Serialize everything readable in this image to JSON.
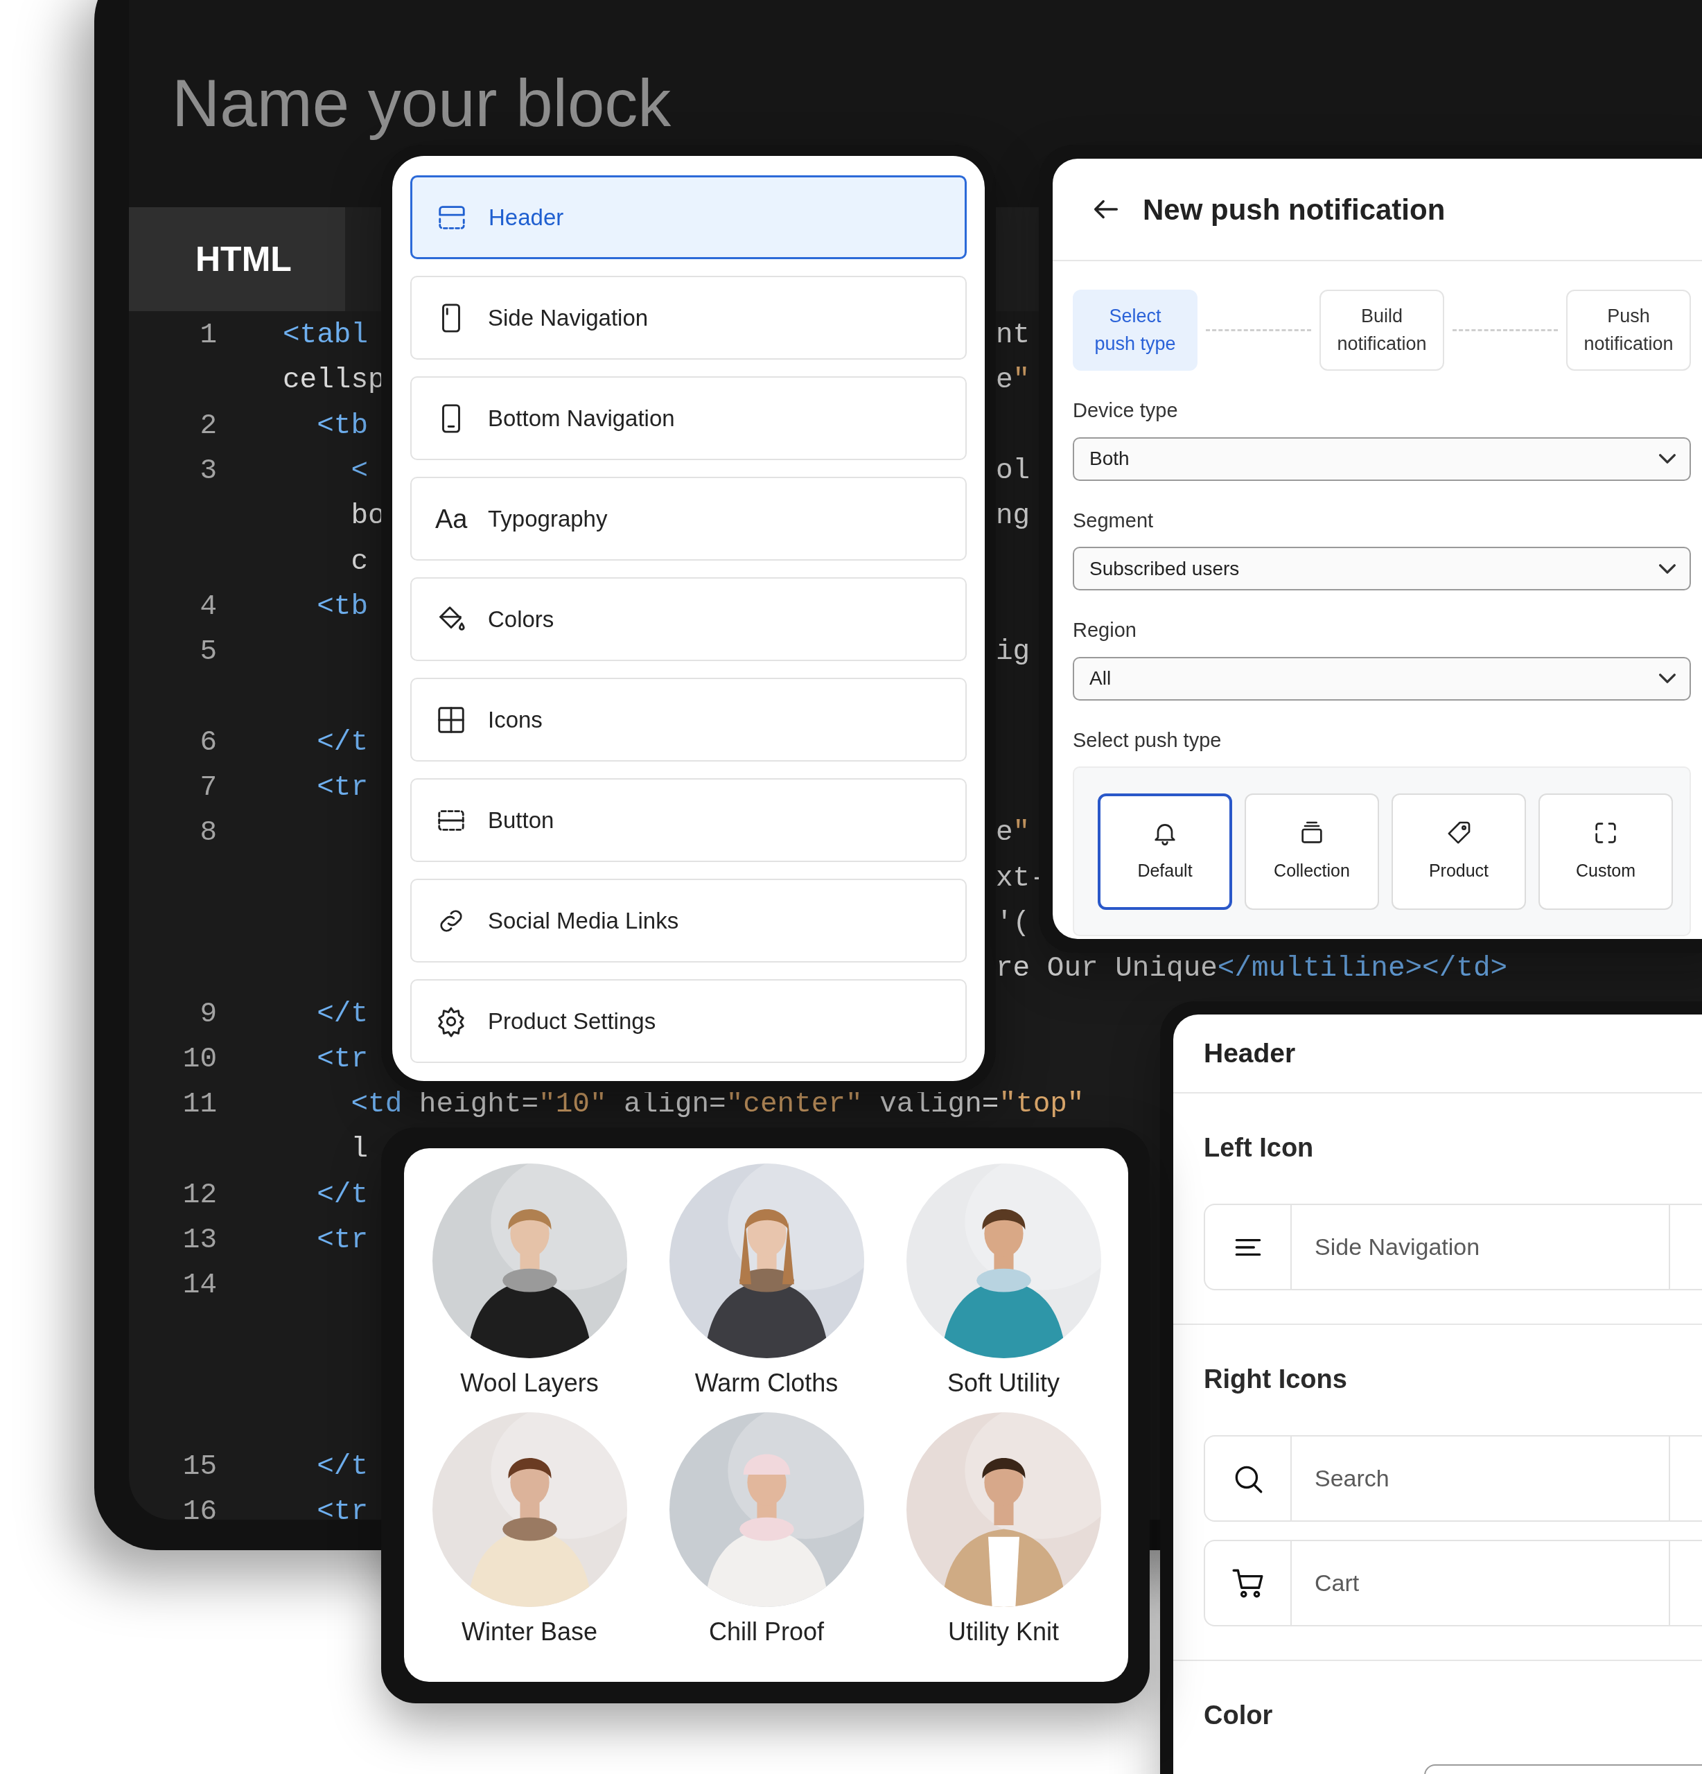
{
  "editor": {
    "title": "Name your block",
    "tabs": [
      {
        "label": "HTML",
        "selected": true
      }
    ],
    "lines": [
      {
        "number": "1",
        "rows": [
          {
            "code": "<tabl",
            "tail": "nt"
          },
          {
            "code": "cellsp",
            "tail": "e\""
          }
        ]
      },
      {
        "number": "2",
        "rows": [
          {
            "code": "  <tb"
          }
        ]
      },
      {
        "number": "3",
        "rows": [
          {
            "code": "    <",
            "tail": "ol"
          },
          {
            "code": "    bo",
            "tail": "ng"
          },
          {
            "code": "    c"
          }
        ]
      },
      {
        "number": "4",
        "rows": [
          {
            "code": "  <tb"
          }
        ]
      },
      {
        "number": "5",
        "rows": [
          {
            "tail": "ig"
          },
          {}
        ]
      },
      {
        "number": "6",
        "rows": [
          {
            "code": "  </t"
          }
        ]
      },
      {
        "number": "7",
        "rows": [
          {
            "code": "  <tr"
          }
        ]
      },
      {
        "number": "8",
        "rows": [
          {
            "tail": "e\""
          },
          {
            "tail": "xt-"
          },
          {
            "tail": "'("
          },
          {
            "tail": "re Our Unique</multiline></td>"
          }
        ]
      },
      {
        "number": "9",
        "rows": [
          {
            "code": "  </t"
          }
        ]
      },
      {
        "number": "10",
        "rows": [
          {
            "code": "  <tr"
          }
        ]
      },
      {
        "number": "11",
        "rows": [
          {
            "code": "    <td height=\"10\" align=\"center\" valign=\"top\""
          },
          {
            "code": "    l"
          }
        ]
      },
      {
        "number": "12",
        "rows": [
          {
            "code": "  </t"
          }
        ]
      },
      {
        "number": "13",
        "rows": [
          {
            "code": "  <tr"
          }
        ]
      },
      {
        "number": "14",
        "rows": [
          {},
          {},
          {},
          {}
        ]
      },
      {
        "number": "15",
        "rows": [
          {
            "code": "  </t"
          }
        ]
      },
      {
        "number": "16",
        "rows": [
          {
            "code": "  <tr"
          }
        ]
      }
    ]
  },
  "blocks_menu": {
    "items": [
      {
        "label": "Header",
        "selected": true
      },
      {
        "label": "Side Navigation",
        "selected": false
      },
      {
        "label": "Bottom Navigation",
        "selected": false
      },
      {
        "label": "Typography",
        "glyph": "Aa",
        "selected": false
      },
      {
        "label": "Colors",
        "selected": false
      },
      {
        "label": "Icons",
        "selected": false
      },
      {
        "label": "Button",
        "selected": false
      },
      {
        "label": "Social Media Links",
        "selected": false
      },
      {
        "label": "Product Settings",
        "selected": false
      }
    ]
  },
  "push_panel": {
    "title": "New push notification",
    "steps": [
      {
        "label": "Select push type",
        "selected": true
      },
      {
        "label": "Build notification",
        "selected": false
      },
      {
        "label": "Push notification",
        "selected": false
      }
    ],
    "fields": [
      {
        "label": "Device type",
        "value": "Both"
      },
      {
        "label": "Segment",
        "value": "Subscribed users"
      },
      {
        "label": "Region",
        "value": "All"
      }
    ],
    "push_type": {
      "label": "Select push type",
      "options": [
        {
          "label": "Default",
          "selected": true
        },
        {
          "label": "Collection",
          "selected": false
        },
        {
          "label": "Product",
          "selected": false
        },
        {
          "label": "Custom",
          "selected": false
        }
      ]
    }
  },
  "header_panel": {
    "title": "Header",
    "sections": [
      {
        "title": "Left Icon",
        "kind": "icons",
        "rows": [
          {
            "label": "Side Navigation"
          }
        ]
      },
      {
        "title": "Right Icons",
        "kind": "icons",
        "rows": [
          {
            "label": "Search"
          },
          {
            "label": "Cart"
          }
        ]
      },
      {
        "title": "Color",
        "kind": "color"
      }
    ]
  },
  "collections": {
    "items": [
      {
        "label": "Wool Layers",
        "kind": "picture"
      },
      {
        "label": "Warm Cloths",
        "kind": "picture"
      },
      {
        "label": "Soft Utility",
        "kind": "picture"
      },
      {
        "label": "Winter Base",
        "kind": "picture"
      },
      {
        "label": "Chill Proof",
        "kind": "picture"
      },
      {
        "label": "Utility Knit",
        "kind": "picture"
      }
    ]
  }
}
